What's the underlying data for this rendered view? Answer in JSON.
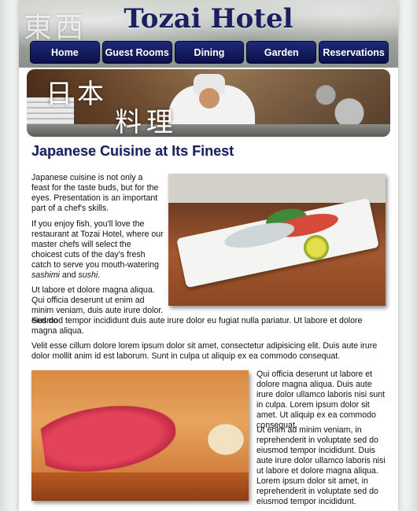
{
  "header": {
    "logo_kanji": "東西",
    "title": "Tozai Hotel"
  },
  "nav": {
    "items": [
      {
        "label": "Home"
      },
      {
        "label": "Guest Rooms"
      },
      {
        "label": "Dining"
      },
      {
        "label": "Garden"
      },
      {
        "label": "Reservations"
      }
    ]
  },
  "banner": {
    "kanji_line1": "日本",
    "kanji_line2": "料理"
  },
  "main": {
    "heading": "Japanese Cuisine at Its Finest",
    "p1": "Japanese cuisine is not only a feast for the taste buds, but for the eyes. Presentation is an important part of a chef's skills.",
    "p2_before": "If you enjoy fish, you'll love the restaurant at Tozai Hotel, where our master chefs will select the choicest cuts of the day's fresh catch to serve you mouth-watering ",
    "p2_em1": "sashimi",
    "p2_mid": " and ",
    "p2_em2": "sushi",
    "p2_after": ".",
    "p3_part1": "Ut labore et dolore magna aliqua. Qui officia deserunt ut enim ad minim veniam, duis aute irure dolor. Sed do",
    "p3_part2": "eiusmod tempor incididunt duis aute irure dolor eu fugiat nulla pariatur. Ut labore et dolore magna aliqua.",
    "p4": "Velit esse cillum dolore lorem ipsum dolor sit amet, consectetur adipisicing elit. Duis aute irure dolor mollit anim id est laborum. Sunt in culpa ut aliquip ex ea commodo consequat.",
    "p5": "Qui officia deserunt ut labore et dolore magna aliqua. Duis aute irure dolor ullamco laboris nisi sunt in culpa. Lorem ipsum dolor sit amet. Ut aliquip ex ea commodo consequat.",
    "p6": "Ut enim ad minim veniam, in reprehenderit in voluptate sed do eiusmod tempor incididunt. Duis aute irure dolor ullamco laboris nisi ut labore et dolore magna aliqua. Lorem ipsum dolor sit amet, in reprehenderit in voluptate sed do eiusmod tempor incididunt."
  },
  "colors": {
    "brand_navy": "#1a2060",
    "nav_button": "#0a1047"
  }
}
